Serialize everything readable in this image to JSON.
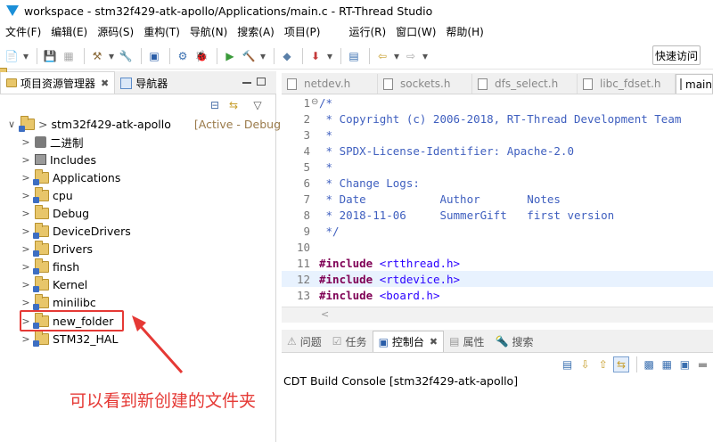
{
  "window": {
    "title": "workspace - stm32f429-atk-apollo/Applications/main.c - RT-Thread Studio"
  },
  "menu": [
    "文件(F)",
    "编辑(E)",
    "源码(S)",
    "重构(T)",
    "导航(N)",
    "搜索(A)",
    "项目(P)",
    "运行(R)",
    "窗口(W)",
    "帮助(H)"
  ],
  "toolbar": {
    "quick_access": "快速访问"
  },
  "left_panel": {
    "tabs": [
      {
        "label": "项目资源管理器",
        "icon": "project-explorer-icon",
        "active": true
      },
      {
        "label": "导航器",
        "icon": "navigator-icon",
        "active": false
      }
    ],
    "project": {
      "name": "stm32f429-atk-apollo",
      "status": "[Active - Debug] [r"
    },
    "items": [
      {
        "label": "二进制",
        "type": "binaries"
      },
      {
        "label": "Includes",
        "type": "includes"
      },
      {
        "label": "Applications",
        "type": "folder"
      },
      {
        "label": "cpu",
        "type": "folder"
      },
      {
        "label": "Debug",
        "type": "folder"
      },
      {
        "label": "DeviceDrivers",
        "type": "folder"
      },
      {
        "label": "Drivers",
        "type": "folder"
      },
      {
        "label": "finsh",
        "type": "folder"
      },
      {
        "label": "Kernel",
        "type": "folder"
      },
      {
        "label": "minilibc",
        "type": "folder"
      },
      {
        "label": "new_folder",
        "type": "folder"
      },
      {
        "label": "STM32_HAL",
        "type": "folder"
      }
    ]
  },
  "editor": {
    "tabs": [
      {
        "label": "netdev.h",
        "active": false
      },
      {
        "label": "sockets.h",
        "active": false
      },
      {
        "label": "dfs_select.h",
        "active": false
      },
      {
        "label": "libc_fdset.h",
        "active": false
      },
      {
        "label": "main",
        "active": true
      }
    ],
    "lines": [
      {
        "num": "1",
        "text": "/*"
      },
      {
        "num": "2",
        "text": " * Copyright (c) 2006-2018, RT-Thread Development Team"
      },
      {
        "num": "3",
        "text": " *"
      },
      {
        "num": "4",
        "text": " * SPDX-License-Identifier: Apache-2.0"
      },
      {
        "num": "5",
        "text": " *"
      },
      {
        "num": "6",
        "text": " * Change Logs:"
      },
      {
        "num": "7",
        "text": " * Date           Author       Notes"
      },
      {
        "num": "8",
        "text": " * 2018-11-06     SummerGift   first version"
      },
      {
        "num": "9",
        "text": " */"
      },
      {
        "num": "10",
        "text": ""
      },
      {
        "num": "11",
        "kw": "#include",
        "rest": " <rtthread.h>"
      },
      {
        "num": "12",
        "kw": "#include",
        "rest": " <rtdevice.h>"
      },
      {
        "num": "13",
        "kw": "#include",
        "rest": " <board.h>"
      }
    ]
  },
  "console": {
    "tabs": [
      {
        "label": "问题",
        "active": false
      },
      {
        "label": "任务",
        "active": false
      },
      {
        "label": "控制台",
        "active": true
      },
      {
        "label": "属性",
        "active": false
      },
      {
        "label": "搜索",
        "active": false
      }
    ],
    "title": "CDT Build Console [stm32f429-atk-apollo]"
  },
  "annotation": {
    "text": "可以看到新创建的文件夹",
    "color": "#e53935"
  }
}
